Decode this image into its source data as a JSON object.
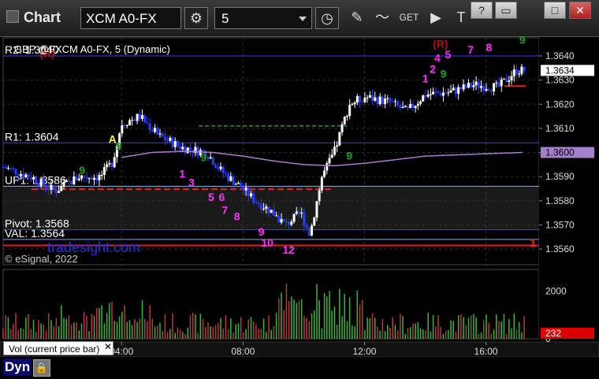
{
  "window": {
    "title": "Chart",
    "symbol": "XCM A0-FX",
    "interval": "5",
    "buttons": [
      "?",
      "▭",
      "□",
      "✕"
    ]
  },
  "chart_header": {
    "reference": "GBP @FXCM A0-FX, 5 (Dynamic)",
    "copyright": "© eSignal, 2022"
  },
  "watermark": "tradesight.com",
  "status": {
    "mode": "Dyn"
  },
  "volume_panel": {
    "label": "Vol (current price bar)",
    "last_value": "232"
  },
  "colors": {
    "background": "#000000",
    "up_bar": "#ffffff",
    "down_bar": "#2a3cff",
    "level_line": "#3a3aff",
    "pivot_fill": "#1a1a1a",
    "vwap": "#a67fcc",
    "counter": "#ff33ff",
    "setup": "#1fa01f",
    "last_price_box": "#ffffff",
    "resistance_line": "#e02020"
  },
  "chart_data": [
    {
      "type": "candlestick",
      "title": "GBP @FXCM A0-FX, 5 (Dynamic)",
      "time_axis": {
        "ticks": [
          "04:00",
          "08:00",
          "12:00",
          "16:00"
        ],
        "tick_hours": [
          4,
          8,
          12,
          16
        ],
        "range_hours": [
          0.1,
          17.75
        ]
      },
      "price_axis": {
        "ticks": [
          "1.3640",
          "1.3630",
          "1.3620",
          "1.3610",
          "1.3600",
          "1.3590",
          "1.3580",
          "1.3570",
          "1.3560"
        ],
        "tick_values": [
          1.364,
          1.363,
          1.362,
          1.361,
          1.36,
          1.359,
          1.358,
          1.357,
          1.356
        ],
        "range": [
          1.35535,
          1.36475
        ]
      },
      "last_price": {
        "label": "1.3634",
        "value": 1.3634
      },
      "vwap_tag": {
        "label": "1.3600",
        "value": 1.36
      },
      "levels": [
        {
          "label": "R2: 1.3640",
          "value": 1.364
        },
        {
          "label": "R1: 1.3604",
          "value": 1.3604
        },
        {
          "label": "UP1: 1.3586",
          "value": 1.3586
        },
        {
          "label": "Pivot: 1.3568",
          "value": 1.3568
        },
        {
          "label": "VAL: 1.3564",
          "value": 1.3564
        }
      ],
      "markers": [
        {
          "text": "(R)",
          "t": 1.55,
          "price": 1.36395,
          "color": "#b01010"
        },
        {
          "text": "(R)",
          "t": 14.5,
          "price": 1.36435,
          "color": "#b01010"
        },
        {
          "text": "A",
          "t": 3.7,
          "price": 1.3604,
          "color": "#ffff33"
        },
        {
          "text": "1",
          "t": 6.0,
          "price": 1.35895,
          "color": "#ff33ff"
        },
        {
          "text": "3",
          "t": 6.3,
          "price": 1.3586,
          "color": "#ff33ff"
        },
        {
          "text": "5",
          "t": 6.95,
          "price": 1.358,
          "color": "#ff33ff"
        },
        {
          "text": "6",
          "t": 7.3,
          "price": 1.358,
          "color": "#ff33ff"
        },
        {
          "text": "7",
          "t": 7.4,
          "price": 1.35745,
          "color": "#ff33ff"
        },
        {
          "text": "8",
          "t": 7.8,
          "price": 1.3572,
          "color": "#ff33ff"
        },
        {
          "text": "9",
          "t": 8.6,
          "price": 1.35655,
          "color": "#ff33ff"
        },
        {
          "text": "10",
          "t": 8.8,
          "price": 1.3561,
          "color": "#ff33ff"
        },
        {
          "text": "12",
          "t": 9.5,
          "price": 1.3558,
          "color": "#ff33ff"
        },
        {
          "text": "1",
          "t": 14.0,
          "price": 1.3629,
          "color": "#ff33ff"
        },
        {
          "text": "2",
          "t": 14.25,
          "price": 1.3633,
          "color": "#ff33ff"
        },
        {
          "text": "4",
          "t": 14.4,
          "price": 1.36375,
          "color": "#ff33ff"
        },
        {
          "text": "5",
          "t": 14.75,
          "price": 1.3639,
          "color": "#ff33ff"
        },
        {
          "text": "7",
          "t": 15.5,
          "price": 1.3641,
          "color": "#ff33ff"
        },
        {
          "text": "8",
          "t": 16.1,
          "price": 1.3642,
          "color": "#ff33ff"
        },
        {
          "text": "9",
          "t": 2.7,
          "price": 1.3591,
          "color": "#1fa01f"
        },
        {
          "text": "9",
          "t": 3.9,
          "price": 1.3601,
          "color": "#1fa01f"
        },
        {
          "text": "9",
          "t": 6.7,
          "price": 1.35965,
          "color": "#1fa01f"
        },
        {
          "text": "9",
          "t": 11.5,
          "price": 1.3597,
          "color": "#1fa01f"
        },
        {
          "text": "9",
          "t": 14.6,
          "price": 1.3631,
          "color": "#1fa01f"
        },
        {
          "text": "9",
          "t": 17.2,
          "price": 1.3645,
          "color": "#1fa01f"
        },
        {
          "text": "1",
          "t": 17.55,
          "price": 1.3561,
          "color": "#ff2020"
        }
      ]
    },
    {
      "type": "bar",
      "title": "Vol (current price bar)",
      "y_axis": {
        "ticks": [
          "2000",
          "0"
        ],
        "tick_values": [
          2000,
          0
        ],
        "range": [
          0,
          2900
        ]
      },
      "last_value": 232
    }
  ]
}
